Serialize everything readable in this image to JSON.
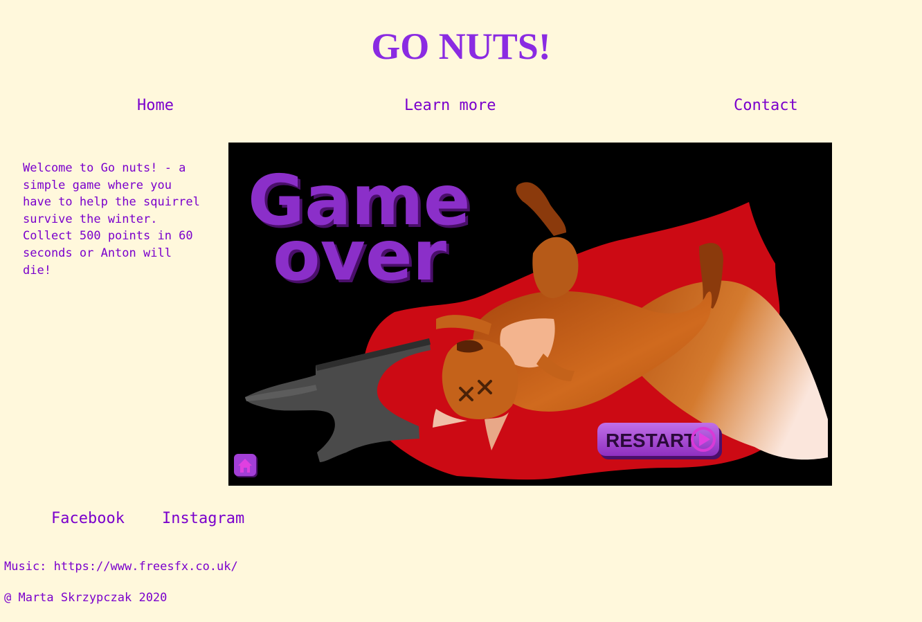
{
  "header": {
    "title": "GO NUTS!"
  },
  "nav": {
    "home": "Home",
    "learn_more": "Learn more",
    "contact": "Contact"
  },
  "intro": {
    "text": "Welcome to Go nuts! - a simple game where you have to help the squirrel survive the winter. Collect 500 points in 60 seconds or Anton will die!"
  },
  "game": {
    "headline_line1": "Game",
    "headline_line2": "over",
    "restart_label": "RESTART",
    "home_button_icon": "home-icon",
    "restart_icon": "play-icon"
  },
  "social": {
    "facebook": "Facebook",
    "instagram": "Instagram"
  },
  "footer": {
    "music": "Music: https://www.freesfx.co.uk/",
    "copyright": "@ Marta Skrzypczak 2020"
  },
  "colors": {
    "background": "#fff8dc",
    "title": "#8a2be2",
    "link": "#7a00cc",
    "game_bg": "#000000",
    "blood": "#cc0a14",
    "squirrel": "#c8621c",
    "button_purple": "#9b3fd0"
  }
}
